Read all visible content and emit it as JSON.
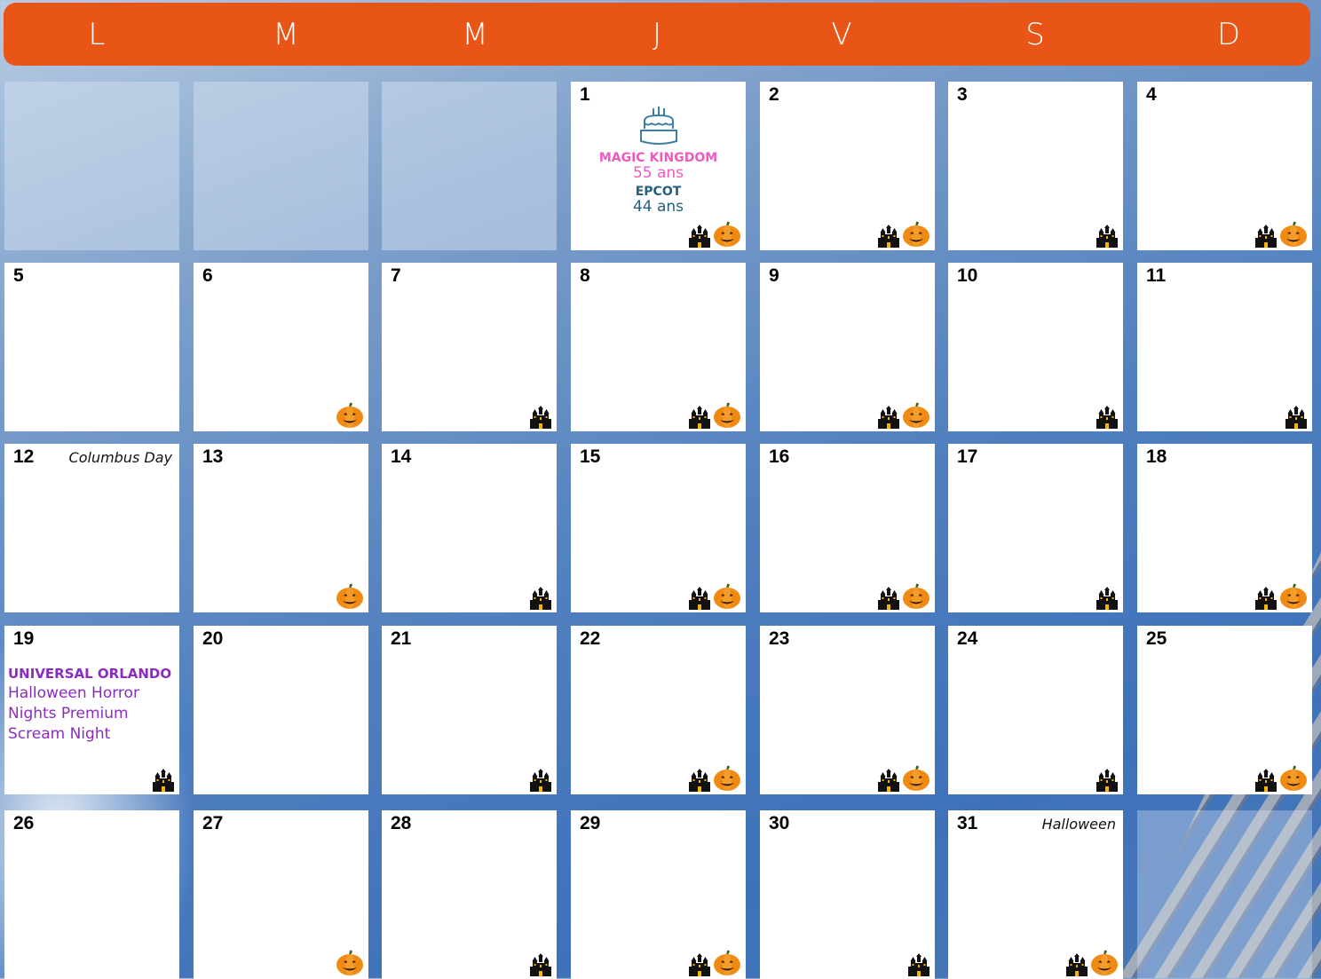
{
  "colors": {
    "header_bg": "#e85516",
    "pink": "#f05ac0",
    "teal": "#25607e",
    "purple": "#8a2cc0",
    "pumpkin": "#f08a12",
    "castle": "#111111"
  },
  "icons": [
    "castle-icon",
    "pumpkin-icon",
    "birthday-cake-icon"
  ],
  "weekdays": [
    "L",
    "M",
    "M",
    "J",
    "V",
    "S",
    "D"
  ],
  "days": [
    {
      "num": "1",
      "castle": true,
      "pumpkin": true
    },
    {
      "num": "2",
      "castle": true,
      "pumpkin": true
    },
    {
      "num": "3",
      "castle": true,
      "pumpkin": false
    },
    {
      "num": "4",
      "castle": true,
      "pumpkin": true
    },
    {
      "num": "5",
      "castle": false,
      "pumpkin": false
    },
    {
      "num": "6",
      "castle": false,
      "pumpkin": true
    },
    {
      "num": "7",
      "castle": true,
      "pumpkin": false
    },
    {
      "num": "8",
      "castle": true,
      "pumpkin": true
    },
    {
      "num": "9",
      "castle": true,
      "pumpkin": true
    },
    {
      "num": "10",
      "castle": true,
      "pumpkin": false
    },
    {
      "num": "11",
      "castle": true,
      "pumpkin": false
    },
    {
      "num": "12",
      "castle": false,
      "pumpkin": false,
      "note": "Columbus Day"
    },
    {
      "num": "13",
      "castle": false,
      "pumpkin": true
    },
    {
      "num": "14",
      "castle": true,
      "pumpkin": false
    },
    {
      "num": "15",
      "castle": true,
      "pumpkin": true
    },
    {
      "num": "16",
      "castle": true,
      "pumpkin": true
    },
    {
      "num": "17",
      "castle": true,
      "pumpkin": false
    },
    {
      "num": "18",
      "castle": true,
      "pumpkin": true
    },
    {
      "num": "19",
      "castle": true,
      "pumpkin": false
    },
    {
      "num": "20",
      "castle": false,
      "pumpkin": false
    },
    {
      "num": "21",
      "castle": true,
      "pumpkin": false
    },
    {
      "num": "22",
      "castle": true,
      "pumpkin": true
    },
    {
      "num": "23",
      "castle": true,
      "pumpkin": true
    },
    {
      "num": "24",
      "castle": true,
      "pumpkin": false
    },
    {
      "num": "25",
      "castle": true,
      "pumpkin": true
    },
    {
      "num": "26",
      "castle": false,
      "pumpkin": false
    },
    {
      "num": "27",
      "castle": false,
      "pumpkin": true
    },
    {
      "num": "28",
      "castle": true,
      "pumpkin": false
    },
    {
      "num": "29",
      "castle": true,
      "pumpkin": true
    },
    {
      "num": "30",
      "castle": true,
      "pumpkin": false
    },
    {
      "num": "31",
      "castle": true,
      "pumpkin": true,
      "note": "Halloween"
    }
  ],
  "events": {
    "day1": {
      "line1_title": "MAGIC KINGDOM",
      "line1_text": "55 ans",
      "line2_title": "EPCOT",
      "line2_text": "44 ans"
    },
    "day19": {
      "title": "UNIVERSAL ORLANDO",
      "line1": "Halloween Horror",
      "line2": "Nights Premium",
      "line3": "Scream Night"
    }
  }
}
